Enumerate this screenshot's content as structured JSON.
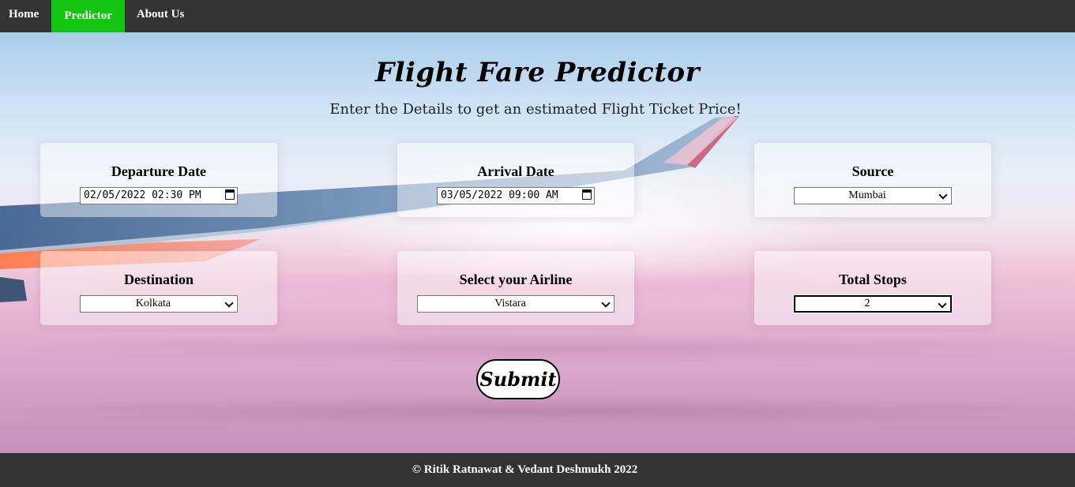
{
  "nav": {
    "items": [
      {
        "label": "Home",
        "active": false
      },
      {
        "label": "Predictor",
        "active": true
      },
      {
        "label": "About Us",
        "active": false
      }
    ]
  },
  "header": {
    "title": "Flight Fare Predictor",
    "subtitle": "Enter the Details to get an estimated Flight Ticket Price!"
  },
  "form": {
    "departure": {
      "label": "Departure Date",
      "value": "02/05/2022 02:30 PM"
    },
    "arrival": {
      "label": "Arrival Date",
      "value": "03/05/2022 09:00 AM"
    },
    "source": {
      "label": "Source",
      "value": "Mumbai"
    },
    "destination": {
      "label": "Destination",
      "value": "Kolkata"
    },
    "airline": {
      "label": "Select your Airline",
      "value": "Vistara"
    },
    "stops": {
      "label": "Total Stops",
      "value": "2"
    },
    "submit_label": "Submit"
  },
  "footer": {
    "text": "© Ritik Ratnawat & Vedant Deshmukh 2022"
  },
  "colors": {
    "nav_bg": "#333333",
    "active_tab": "#11c511",
    "footer_bg": "#333333"
  }
}
